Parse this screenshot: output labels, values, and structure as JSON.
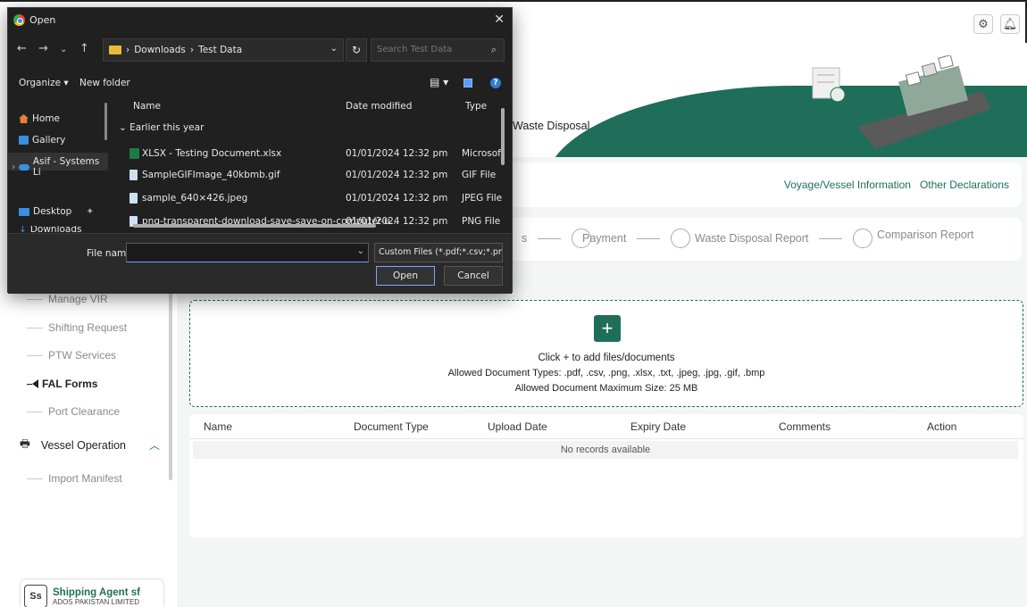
{
  "app": {
    "hero_title": "Waste Disposal",
    "nav_links": [
      "Voyage/Vessel Information",
      "Other Declarations"
    ],
    "steps": [
      {
        "label": "s"
      },
      {
        "label": "Payment"
      },
      {
        "label": "Waste Disposal Report"
      },
      {
        "label": "Comparison Report"
      }
    ],
    "upload": {
      "line1": "Click + to add files/documents",
      "line2": "Allowed Document Types: .pdf, .csv, .png, .xlsx, .txt, .jpeg, .jpg, .gif, .bmp",
      "line3": "Allowed Document Maximum Size: 25 MB"
    },
    "table": {
      "columns": [
        "Name",
        "Document Type",
        "Upload Date",
        "Expiry Date",
        "Comments",
        "Action"
      ],
      "empty": "No records available"
    }
  },
  "sidebar": {
    "items": [
      {
        "label": "Manage VIR"
      },
      {
        "label": "Shifting Request"
      },
      {
        "label": "PTW Services"
      },
      {
        "label": "FAL Forms",
        "active": true
      },
      {
        "label": "Port Clearance"
      }
    ],
    "group": "Vessel Operation",
    "sub_items": [
      "Import Manifest"
    ],
    "agent_initials": "Ss",
    "agent_name": "Shipping Agent sf",
    "agent_company": "ADOS PAKISTAN LIMITED"
  },
  "dialog": {
    "title": "Open",
    "breadcrumb": [
      "Downloads",
      "Test Data"
    ],
    "search_placeholder": "Search Test Data",
    "organize": "Organize",
    "new_folder": "New folder",
    "nav_pane": [
      "Home",
      "Gallery",
      "Asif - Systems Li",
      "Desktop",
      "Downloads"
    ],
    "columns": [
      "Name",
      "Date modified",
      "Type"
    ],
    "group": "Earlier this year",
    "files": [
      {
        "name": "XLSX - Testing Document.xlsx",
        "date": "01/01/2024 12:32 pm",
        "type": "Microsoft"
      },
      {
        "name": "SampleGIFImage_40kbmb.gif",
        "date": "01/01/2024 12:32 pm",
        "type": "GIF File"
      },
      {
        "name": "sample_640×426.jpeg",
        "date": "01/01/2024 12:32 pm",
        "type": "JPEG File"
      },
      {
        "name": "png-transparent-download-save-save-on-computer-u...",
        "date": "01/01/2024 12:32 pm",
        "type": "PNG File"
      }
    ],
    "file_name_label": "File name:",
    "file_name_value": "",
    "file_type": "Custom Files (*.pdf;*.csv;*.png;*.",
    "open_label": "Open",
    "cancel_label": "Cancel"
  },
  "colors": {
    "accent": "#1e6e5a",
    "dialog_bg": "#202020"
  }
}
